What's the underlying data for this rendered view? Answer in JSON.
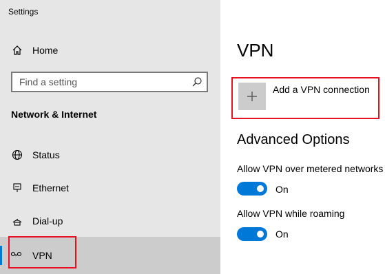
{
  "window": {
    "title": "Settings"
  },
  "sidebar": {
    "home_label": "Home",
    "search_placeholder": "Find a setting",
    "section_header": "Network & Internet",
    "items": [
      {
        "label": "Status",
        "icon": "globe-icon"
      },
      {
        "label": "Ethernet",
        "icon": "ethernet-icon"
      },
      {
        "label": "Dial-up",
        "icon": "dialup-icon"
      },
      {
        "label": "VPN",
        "icon": "vpn-icon",
        "selected": true
      }
    ]
  },
  "main": {
    "title": "VPN",
    "add_vpn_label": "Add a VPN connection",
    "advanced_header": "Advanced Options",
    "options": [
      {
        "label": "Allow VPN over metered networks",
        "state": "On"
      },
      {
        "label": "Allow VPN while roaming",
        "state": "On"
      }
    ]
  },
  "colors": {
    "accent": "#0078d7",
    "highlight": "#e81123",
    "sidebar_bg": "#e6e6e6"
  }
}
